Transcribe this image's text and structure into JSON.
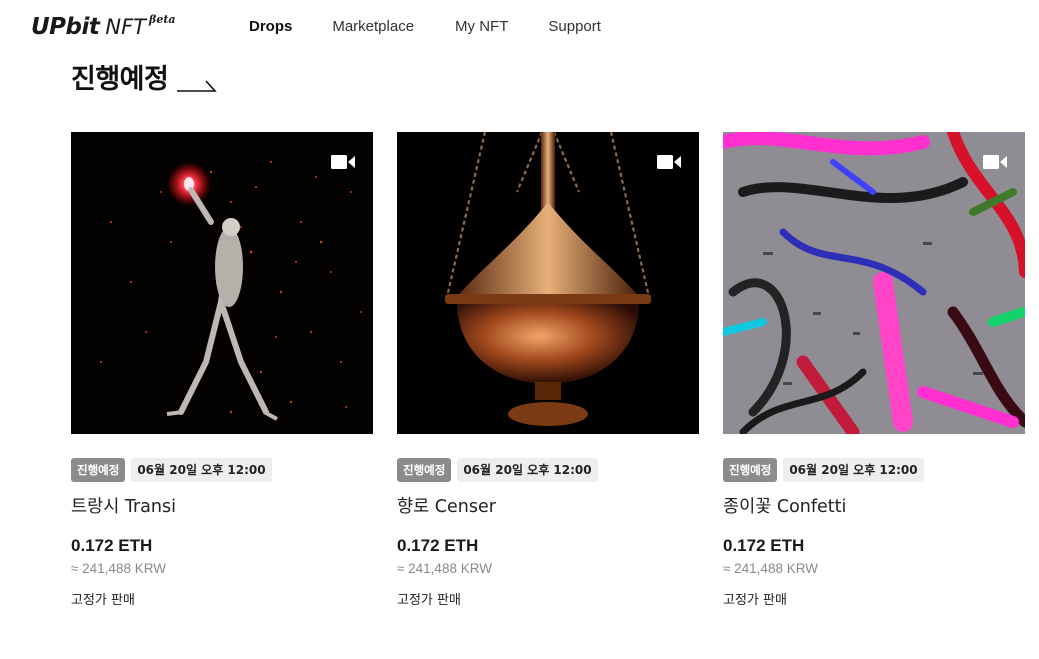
{
  "header": {
    "logo": {
      "main": "UPbit",
      "product": "NFT",
      "tag": "Beta"
    },
    "nav": [
      {
        "label": "Drops",
        "active": true
      },
      {
        "label": "Marketplace",
        "active": false
      },
      {
        "label": "My NFT",
        "active": false
      },
      {
        "label": "Support",
        "active": false
      }
    ]
  },
  "section": {
    "title": "진행예정",
    "arrow_icon": "arrow-right-icon"
  },
  "cards": [
    {
      "image_desc_icon": "video-icon",
      "status": "진행예정",
      "date": "06월 20일 오후 12:00",
      "name": "트랑시 Transi",
      "price": "0.172 ETH",
      "krw": "≈ 241,488 KRW",
      "sale_type": "고정가 판매"
    },
    {
      "image_desc_icon": "video-icon",
      "status": "진행예정",
      "date": "06월 20일 오후 12:00",
      "name": "향로 Censer",
      "price": "0.172 ETH",
      "krw": "≈ 241,488 KRW",
      "sale_type": "고정가 판매"
    },
    {
      "image_desc_icon": "video-icon",
      "status": "진행예정",
      "date": "06월 20일 오후 12:00",
      "name": "종이꽃 Confetti",
      "price": "0.172 ETH",
      "krw": "≈ 241,488 KRW",
      "sale_type": "고정가 판매"
    }
  ],
  "colors": {
    "status_badge_bg": "#8c8c8c",
    "date_badge_bg": "#eeeeee",
    "text_primary": "#1b1b1b",
    "text_secondary": "#8a8a8a"
  }
}
